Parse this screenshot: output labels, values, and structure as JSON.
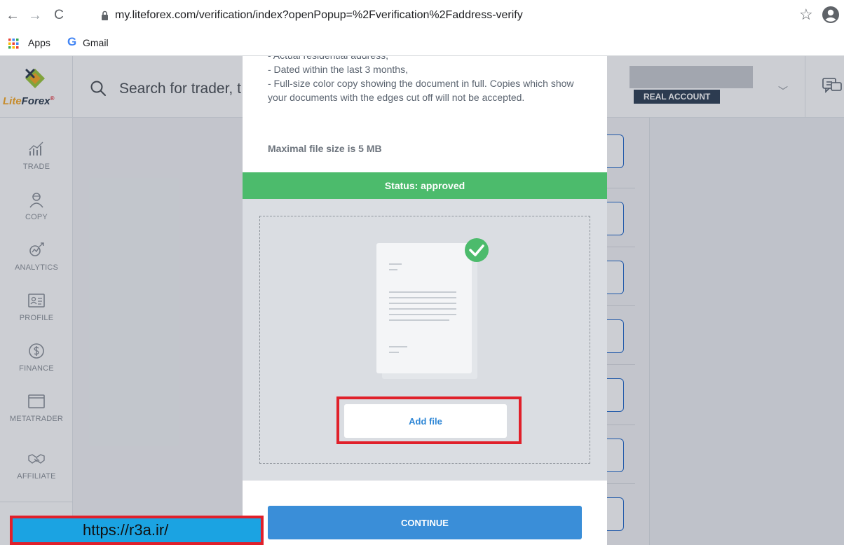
{
  "browser": {
    "url": "my.liteforex.com/verification/index?openPopup=%2Fverification%2Faddress-verify",
    "nav_icons": [
      "back-arrow-icon",
      "forward-arrow-icon",
      "reload-icon",
      "lock-icon",
      "star-icon",
      "profile-icon"
    ],
    "back_glyph": "←",
    "forward_glyph": "→",
    "reload_glyph": "C",
    "star_glyph": "☆",
    "bookmarks": [
      {
        "label": "Apps",
        "icon": "apps-grid-icon"
      },
      {
        "label": "Gmail",
        "icon": "google-g-icon",
        "icon_glyph": "G"
      }
    ]
  },
  "app": {
    "logo": {
      "text_a": "Lite",
      "text_b": "Forex",
      "mark": "®"
    },
    "search": {
      "placeholder": "Search for trader, t"
    },
    "account": {
      "badge": "REAL ACCOUNT",
      "chevron": "﹀"
    },
    "sidebar": {
      "items": [
        {
          "label": "TRADE",
          "icon": "trade-chart-icon"
        },
        {
          "label": "COPY",
          "icon": "copy-trader-icon"
        },
        {
          "label": "ANALYTICS",
          "icon": "analytics-icon"
        },
        {
          "label": "PROFILE",
          "icon": "profile-card-icon"
        },
        {
          "label": "FINANCE",
          "icon": "dollar-coin-icon"
        },
        {
          "label": "METATRADER",
          "icon": "metatrader-window-icon"
        },
        {
          "label": "AFFILIATE",
          "icon": "handshake-icon"
        }
      ]
    }
  },
  "modal": {
    "requirements": [
      "- Actual residential address,",
      "- Dated within the last 3 months,",
      "- Full-size color copy showing the document in full. Copies which show your documents with the edges cut off will not be accepted."
    ],
    "max_size": "Maximal file size is 5 MB",
    "status": "Status: approved",
    "add_file": "Add file",
    "continue": "CONTINUE"
  },
  "colors": {
    "status_green": "#4cbb6c",
    "continue_blue": "#3a8ed8",
    "link_blue": "#2f87d6",
    "highlight_red": "#e0202a",
    "badge_navy": "#2d3f54",
    "logo_orange": "#f7a823"
  },
  "watermark": {
    "text": "https://r3a.ir/"
  }
}
